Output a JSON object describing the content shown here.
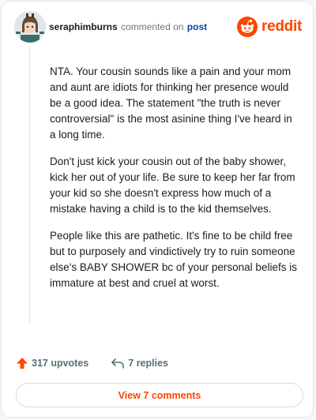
{
  "comment": {
    "username": "seraphimburns",
    "action_text": "commented on",
    "post_link_label": "post",
    "paragraphs": [
      "NTA. Your cousin sounds like a pain and your mom and aunt are idiots for thinking her presence would be a good idea. The statement \"the truth is never controversial\" is the most asinine thing I've heard in a long time.",
      "Don't just kick your cousin out of the baby shower, kick her out of your life. Be sure to keep her far from your kid so she doesn't express how much of a mistake having a child is to the kid themselves.",
      "People like this are pathetic. It's fine to be child free but to purposely and vindictively try to ruin someone else's BABY SHOWER bc of your personal beliefs is immature at best and cruel at worst."
    ]
  },
  "brand": {
    "wordmark": "reddit",
    "icon": "reddit-logo-icon"
  },
  "footer": {
    "upvotes_label": "317 upvotes",
    "replies_label": "7 replies",
    "view_comments_label": "View 7 comments"
  },
  "colors": {
    "accent": "#ff4500",
    "link": "#0045ac",
    "muted": "#576f76",
    "text": "#1c1c1c"
  },
  "icons": {
    "upvote": "upvote-arrow-icon",
    "reply": "reply-arrow-icon",
    "avatar": "user-avatar"
  }
}
